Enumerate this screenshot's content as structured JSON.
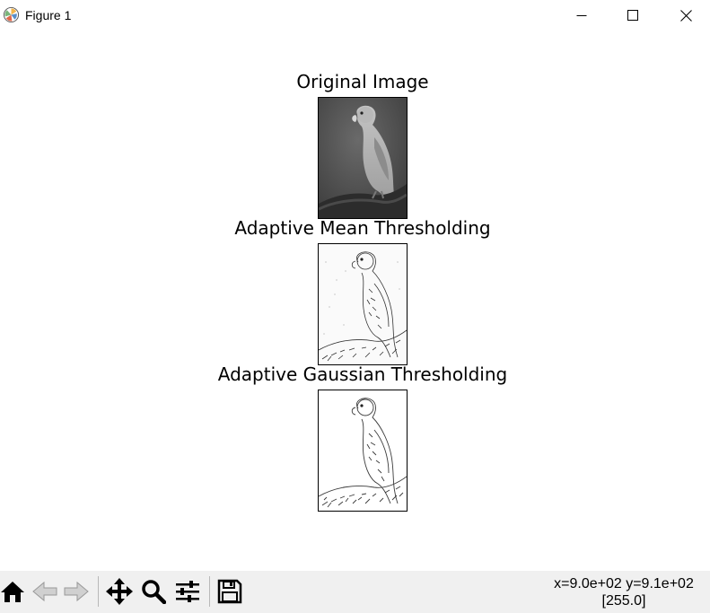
{
  "window": {
    "title": "Figure 1"
  },
  "subplots": [
    {
      "title": "Original Image",
      "image": "grayscale photo of a parrot perched on a branch"
    },
    {
      "title": "Adaptive Mean Thresholding",
      "image": "binary edge image of the parrot"
    },
    {
      "title": "Adaptive Gaussian Thresholding",
      "image": "binary edge image of the parrot"
    }
  ],
  "toolbar": {
    "buttons": [
      "home-icon",
      "back-arrow-icon",
      "forward-arrow-icon",
      "pan-icon",
      "zoom-icon",
      "configure-subplots-icon",
      "save-icon"
    ]
  },
  "status": {
    "coords": "x=9.0e+02 y=9.1e+02",
    "value": "[255.0]"
  }
}
